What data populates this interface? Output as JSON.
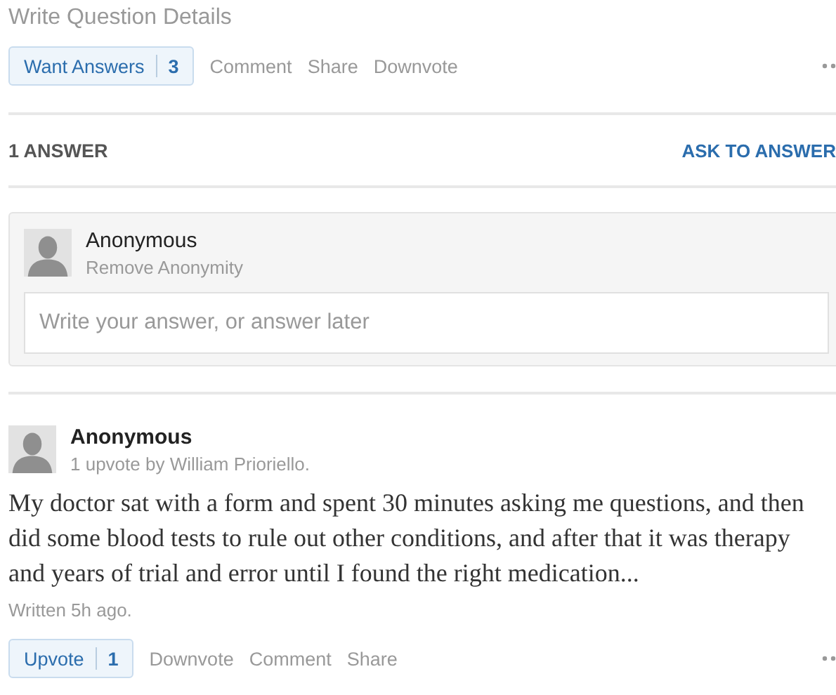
{
  "question": {
    "details_link": "Write Question Details",
    "want_answers": {
      "label": "Want Answers",
      "count": "3"
    },
    "actions": [
      "Comment",
      "Share",
      "Downvote"
    ]
  },
  "answers_header": {
    "count_label": "1 ANSWER",
    "ask_link": "ASK TO ANSWER"
  },
  "composer": {
    "name": "Anonymous",
    "anonymity_link": "Remove Anonymity",
    "placeholder": "Write your answer, or answer later"
  },
  "answer": {
    "author": "Anonymous",
    "upvote_note": "1 upvote by William Prioriello.",
    "text": "My doctor sat with a form and spent 30 minutes asking me questions, and then\ndid some blood tests to rule out other conditions, and after that it was therapy\nand years of trial and error until I found the right medication...",
    "written": "Written 5h ago.",
    "upvote": {
      "label": "Upvote",
      "count": "1"
    },
    "actions": [
      "Downvote",
      "Comment",
      "Share"
    ]
  }
}
